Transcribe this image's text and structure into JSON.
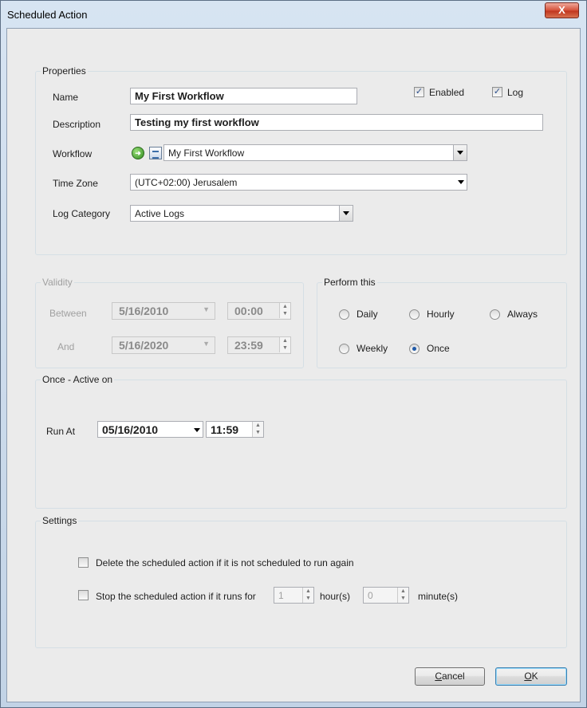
{
  "window": {
    "title": "Scheduled Action",
    "close_glyph": "X"
  },
  "properties": {
    "group_label": "Properties",
    "name_label": "Name",
    "name_value": "My First Workflow",
    "enabled_label": "Enabled",
    "enabled_checked": true,
    "log_label": "Log",
    "log_checked": true,
    "description_label": "Description",
    "description_value": "Testing my first workflow",
    "workflow_label": "Workflow",
    "workflow_value": "My First Workflow",
    "timezone_label": "Time Zone",
    "timezone_value": "(UTC+02:00) Jerusalem",
    "logcategory_label": "Log Category",
    "logcategory_value": "Active Logs"
  },
  "validity": {
    "group_label": "Validity",
    "between_label": "Between",
    "between_date": "5/16/2010",
    "between_time": "00:00",
    "and_label": "And",
    "and_date": "5/16/2020",
    "and_time": "23:59"
  },
  "perform": {
    "group_label": "Perform this",
    "options": [
      "Daily",
      "Hourly",
      "Always",
      "Weekly",
      "Once"
    ],
    "selected": "Once"
  },
  "once": {
    "group_label": "Once - Active on",
    "run_at_label": "Run At",
    "date_value": "05/16/2010",
    "time_value": "11:59"
  },
  "settings": {
    "group_label": "Settings",
    "delete_label": "Delete the scheduled action if it is not scheduled to run again",
    "stop_label": "Stop the scheduled action if it runs for",
    "hours_value": "1",
    "hours_label": "hour(s)",
    "minutes_value": "0",
    "minutes_label": "minute(s)"
  },
  "buttons": {
    "cancel": "Cancel",
    "ok": "OK"
  }
}
